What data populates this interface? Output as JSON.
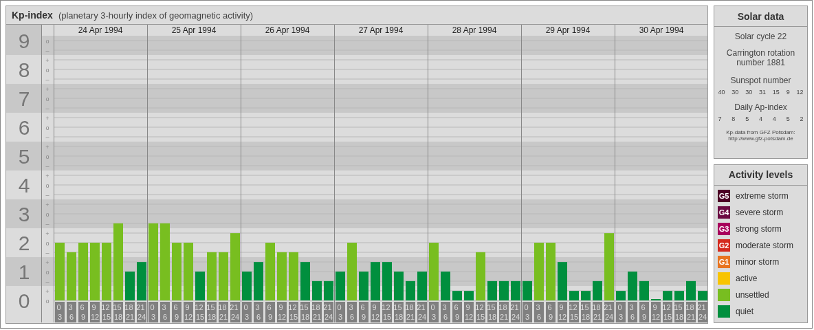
{
  "header": {
    "title": "Kp-index",
    "subtitle": "(planetary 3-hourly index of geomagnetic activity)"
  },
  "chart": {
    "minor_marks": [
      [
        "o",
        "–"
      ],
      [
        "+",
        "o",
        "–"
      ],
      [
        "+",
        "o",
        "–"
      ],
      [
        "+",
        "o",
        "–"
      ],
      [
        "+",
        "o",
        "–"
      ],
      [
        "+",
        "o",
        "–"
      ],
      [
        "+",
        "o",
        "–"
      ],
      [
        "+",
        "o",
        "–"
      ],
      [
        "+",
        "o",
        "–"
      ],
      [
        "+",
        "o"
      ]
    ],
    "days": [
      "24 Apr 1994",
      "25 Apr 1994",
      "26 Apr 1994",
      "27 Apr 1994",
      "28 Apr 1994",
      "29 Apr 1994",
      "30 Apr 1994"
    ],
    "chart_data": {
      "type": "bar",
      "grid": true,
      "ylim": [
        0,
        9
      ],
      "yticks": [
        0,
        1,
        2,
        3,
        4,
        5,
        6,
        7,
        8,
        9
      ],
      "categories": [
        "0 3",
        "3 6",
        "6 9",
        "9 12",
        "12 15",
        "15 18",
        "18 21",
        "21 24",
        "0 3",
        "3 6",
        "6 9",
        "9 12",
        "12 15",
        "15 18",
        "18 21",
        "21 24",
        "0 3",
        "3 6",
        "6 9",
        "9 12",
        "12 15",
        "15 18",
        "18 21",
        "21 24",
        "0 3",
        "3 6",
        "6 9",
        "9 12",
        "12 15",
        "15 18",
        "18 21",
        "21 24",
        "0 3",
        "3 6",
        "6 9",
        "9 12",
        "12 15",
        "15 18",
        "18 21",
        "21 24",
        "0 3",
        "3 6",
        "6 9",
        "9 12",
        "12 15",
        "15 18",
        "18 21",
        "21 24",
        "0 3",
        "3 6",
        "6 9",
        "9 12",
        "12 15",
        "15 18",
        "18 21",
        "21 24"
      ],
      "series": [
        {
          "name": "quiet",
          "color": "#008f3e",
          "values": [
            null,
            null,
            null,
            null,
            null,
            null,
            1,
            1.33,
            null,
            null,
            null,
            null,
            1,
            null,
            null,
            null,
            1,
            1.33,
            null,
            null,
            null,
            1.33,
            0.67,
            0.67,
            1,
            null,
            1,
            1.33,
            1.33,
            1,
            0.67,
            1,
            null,
            1,
            0.33,
            0.33,
            null,
            0.67,
            0.67,
            0.67,
            0.67,
            null,
            null,
            1.33,
            0.33,
            0.33,
            0.67,
            null,
            0.33,
            1,
            0.67,
            0,
            0.33,
            0.33,
            0.67,
            0.33
          ]
        },
        {
          "name": "unsettled",
          "color": "#78be20",
          "values": [
            2,
            1.67,
            2,
            2,
            2,
            2.67,
            null,
            null,
            2.67,
            2.67,
            2,
            2,
            null,
            1.67,
            1.67,
            2.33,
            null,
            null,
            2,
            1.67,
            1.67,
            null,
            null,
            null,
            null,
            2,
            null,
            null,
            null,
            null,
            null,
            null,
            2,
            null,
            null,
            null,
            1.67,
            null,
            null,
            null,
            null,
            2,
            2,
            null,
            null,
            null,
            null,
            2.33,
            null,
            null,
            null,
            null,
            null,
            null,
            null,
            null
          ]
        }
      ]
    }
  },
  "solar_data": {
    "title": "Solar data",
    "solar_cycle": "Solar cycle 22",
    "carrington": "Carrington rotation number 1881",
    "sunspot_label": "Sunspot number",
    "sunspot_numbers": [
      "40",
      "30",
      "30",
      "31",
      "15",
      "9",
      "12"
    ],
    "ap_label": "Daily Ap-index",
    "ap_values": [
      "7",
      "8",
      "5",
      "4",
      "4",
      "5",
      "2"
    ],
    "credit": "Kp-data from GFZ Potsdam:",
    "credit_url": "http://www.gfz-potsdam.de"
  },
  "activity_levels": {
    "title": "Activity levels",
    "items": [
      {
        "badge": "G5",
        "label": "extreme storm",
        "color": "#4d0026"
      },
      {
        "badge": "G4",
        "label": "severe storm",
        "color": "#6b0a42"
      },
      {
        "badge": "G3",
        "label": "strong storm",
        "color": "#a8005c"
      },
      {
        "badge": "G2",
        "label": "moderate storm",
        "color": "#d42a1e"
      },
      {
        "badge": "G1",
        "label": "minor storm",
        "color": "#e87420"
      },
      {
        "label": "active",
        "color": "#f8c400"
      },
      {
        "kind": "chart_series"
      },
      {
        "kind": "chart_series"
      }
    ]
  }
}
